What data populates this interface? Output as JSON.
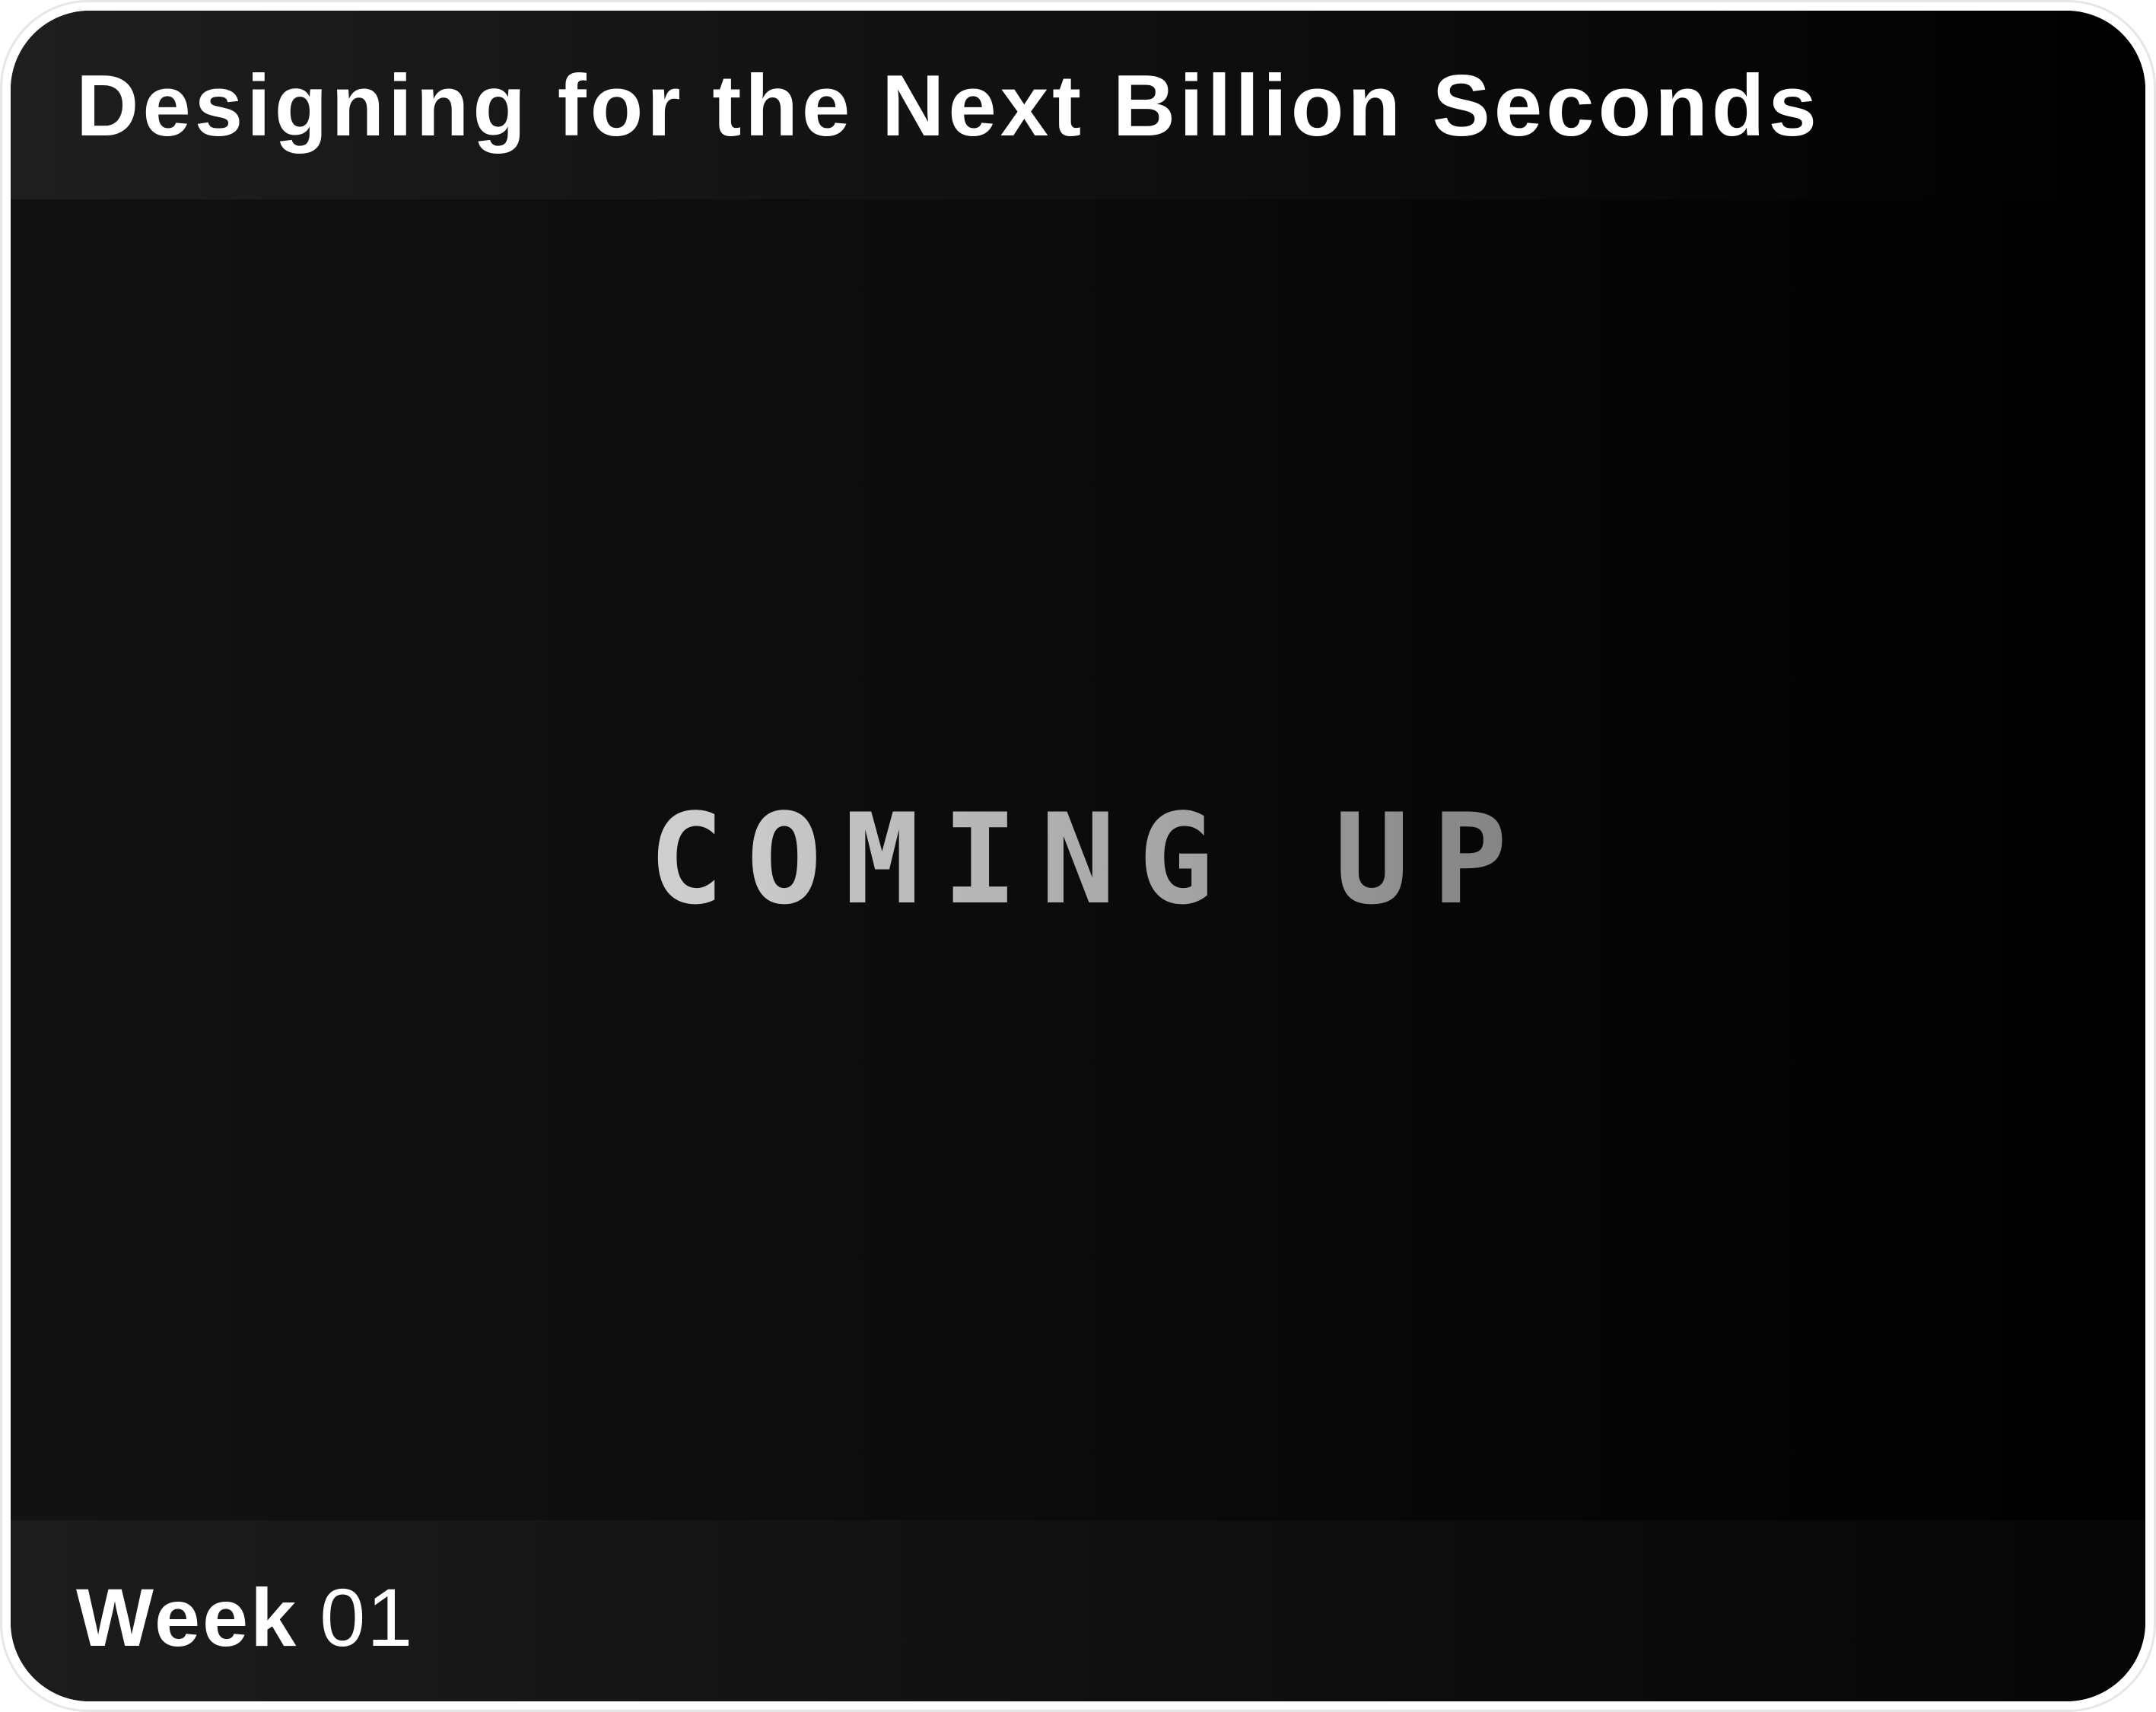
{
  "header": {
    "title": "Designing for the Next Billion Seconds"
  },
  "main": {
    "headline": "COMING UP"
  },
  "footer": {
    "week_label": "Week",
    "week_number": "01"
  },
  "colors": {
    "text": "#ffffff",
    "background": "#0c0c0c",
    "frame": "#ffffff"
  }
}
